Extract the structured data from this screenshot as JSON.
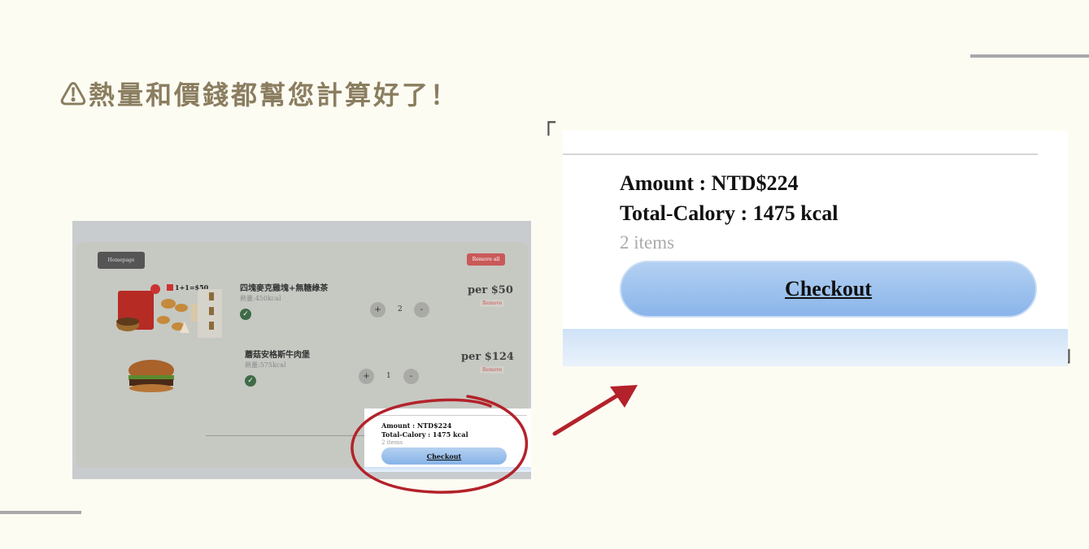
{
  "title": "⚠熱量和價錢都幫您計算好了！",
  "cart": {
    "homepage_label": "Homepage",
    "remove_all_label": "Remove all",
    "items": [
      {
        "name": "四塊麥克雞塊+無糖綠茶",
        "calories": "熱量:450kcal",
        "qty_plus": "+",
        "quantity": "2",
        "qty_minus": "-",
        "price": "per $50",
        "remove_label": "Remove",
        "promo_text": "1+1=$50"
      },
      {
        "name": "蘑菇安格斯牛肉堡",
        "calories": "熱量:575kcal",
        "qty_plus": "+",
        "quantity": "1",
        "qty_minus": "-",
        "price": "per $124",
        "remove_label": "Remove"
      }
    ]
  },
  "summary": {
    "amount": "Amount : NTD$224",
    "total_calory": "Total-Calory : 1475 kcal",
    "items_count": "2 items",
    "checkout_label": "Checkout"
  },
  "colors": {
    "background": "#fdfcf3",
    "title": "#8a7d5f",
    "annotation_red": "#b3222a",
    "checkout_blue": "#8ab5ea"
  },
  "icons": {
    "check": "check-circle-icon",
    "arrow": "arrow-up-right-icon",
    "circle": "highlight-circle"
  }
}
